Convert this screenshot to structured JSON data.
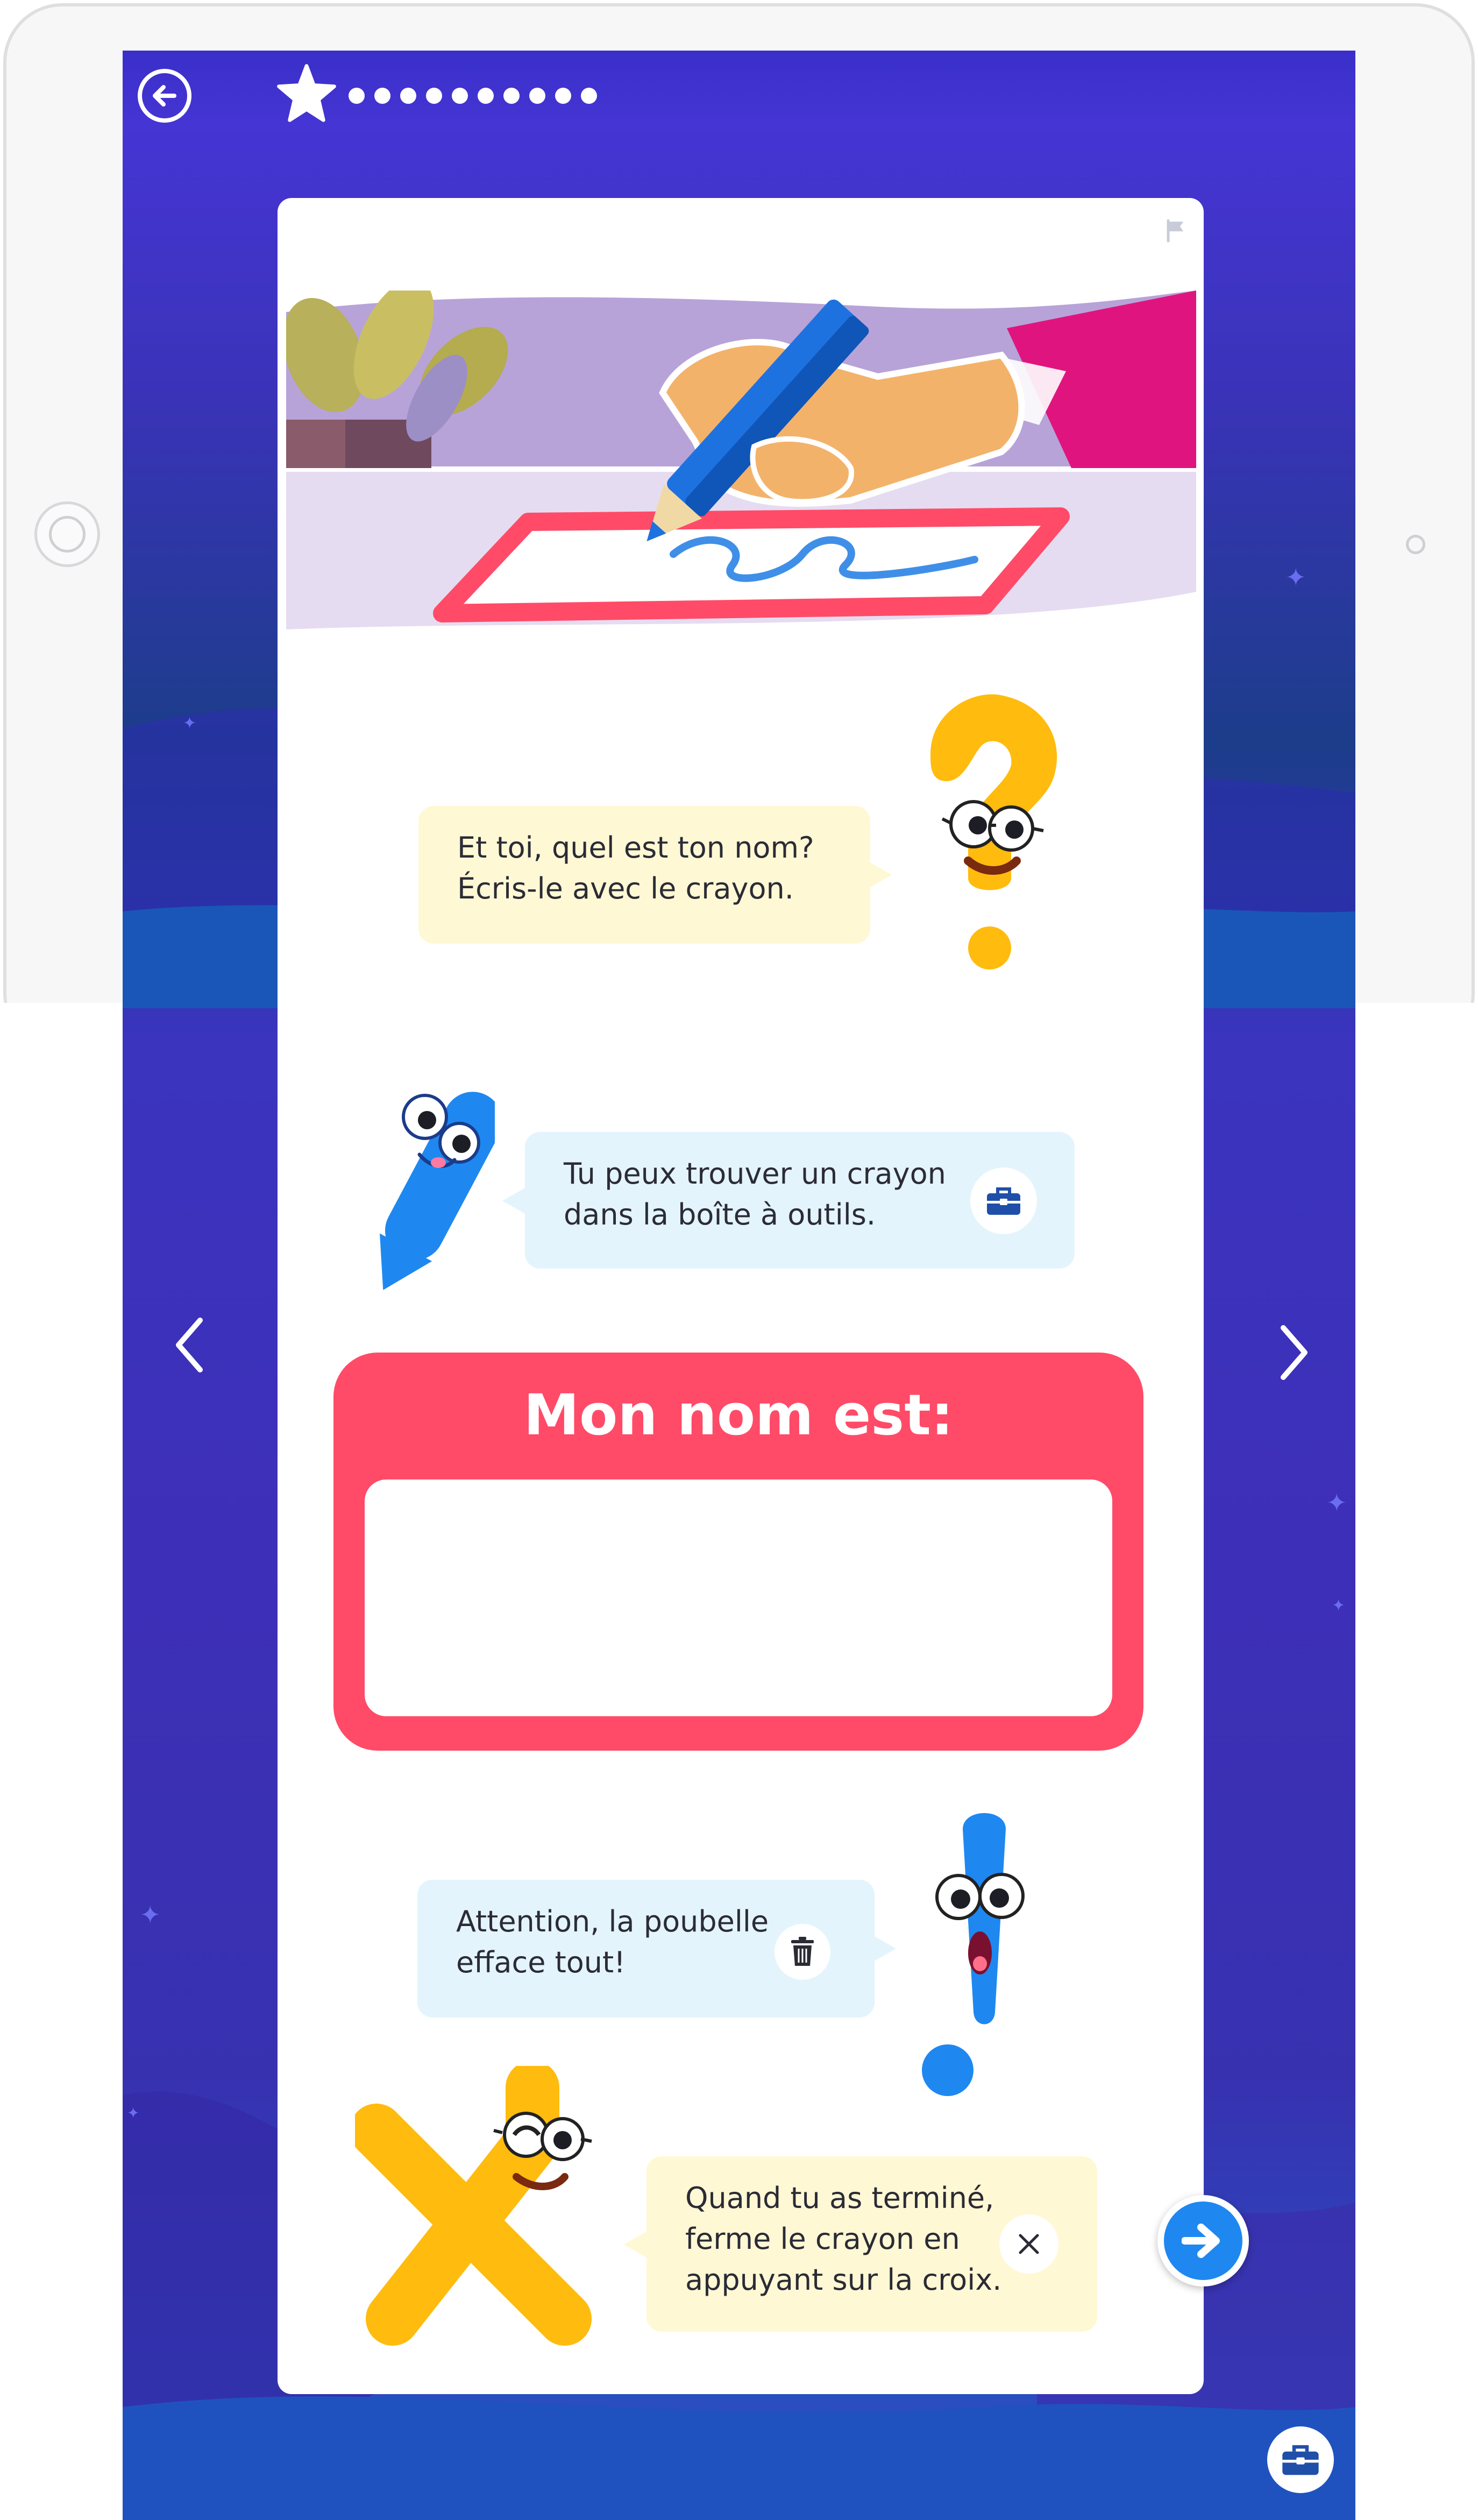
{
  "progress": {
    "current_step": 1,
    "total_steps": 11
  },
  "intro_bubble": {
    "line1": "Et toi, quel est ton nom?",
    "line2": "Écris-le avec le crayon."
  },
  "pencil_bubble": {
    "line1": "Tu peux trouver un crayon",
    "line2": "dans la boîte à outils."
  },
  "name_panel": {
    "title": "Mon nom est:",
    "value": ""
  },
  "trash_bubble": {
    "line1": "Attention, la poubelle",
    "line2": "efface tout!"
  },
  "close_bubble": {
    "line1": "Quand tu as terminé,",
    "line2": "ferme le crayon en",
    "line3": "appuyant sur la croix."
  },
  "icons": {
    "back": "arrow-left-circle-icon",
    "progress_star": "star-icon",
    "flag": "flag-icon",
    "toolbox": "toolbox-icon",
    "trash": "trash-icon",
    "close": "close-x-icon",
    "prev": "chevron-left-icon",
    "next_page": "chevron-right-icon",
    "next": "arrow-right-icon"
  },
  "colors": {
    "background": "#3a33b8",
    "panel": "#ff4b68",
    "yellow_bubble": "#fff8d4",
    "blue_bubble": "#e3f4fc",
    "accent_blue": "#1e88f0",
    "character_yellow": "#ffbb0e"
  }
}
